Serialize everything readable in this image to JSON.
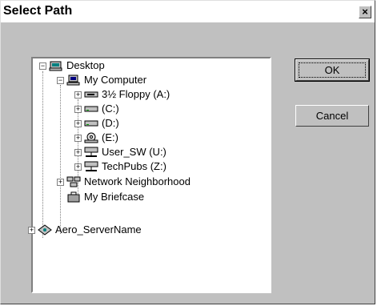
{
  "dialog": {
    "title": "Select Path",
    "close_label": "×"
  },
  "tree": [
    {
      "label": "Desktop",
      "icon": "desktop-icon"
    },
    {
      "label": "My Computer",
      "icon": "computer-icon"
    },
    {
      "label": "3½ Floppy (A:)",
      "icon": "floppy-drive-icon"
    },
    {
      "label": "(C:)",
      "icon": "hard-drive-icon"
    },
    {
      "label": "(D:)",
      "icon": "hard-drive-icon"
    },
    {
      "label": "(E:)",
      "icon": "cd-drive-icon"
    },
    {
      "label": "User_SW (U:)",
      "icon": "network-drive-icon"
    },
    {
      "label": "TechPubs (Z:)",
      "icon": "network-drive-icon"
    },
    {
      "label": "Network Neighborhood",
      "icon": "network-neighborhood-icon"
    },
    {
      "label": "My Briefcase",
      "icon": "briefcase-icon"
    },
    {
      "label": "Aero_ServerName",
      "icon": "server-icon"
    }
  ],
  "buttons": {
    "ok_label": "OK",
    "cancel_label": "Cancel"
  }
}
